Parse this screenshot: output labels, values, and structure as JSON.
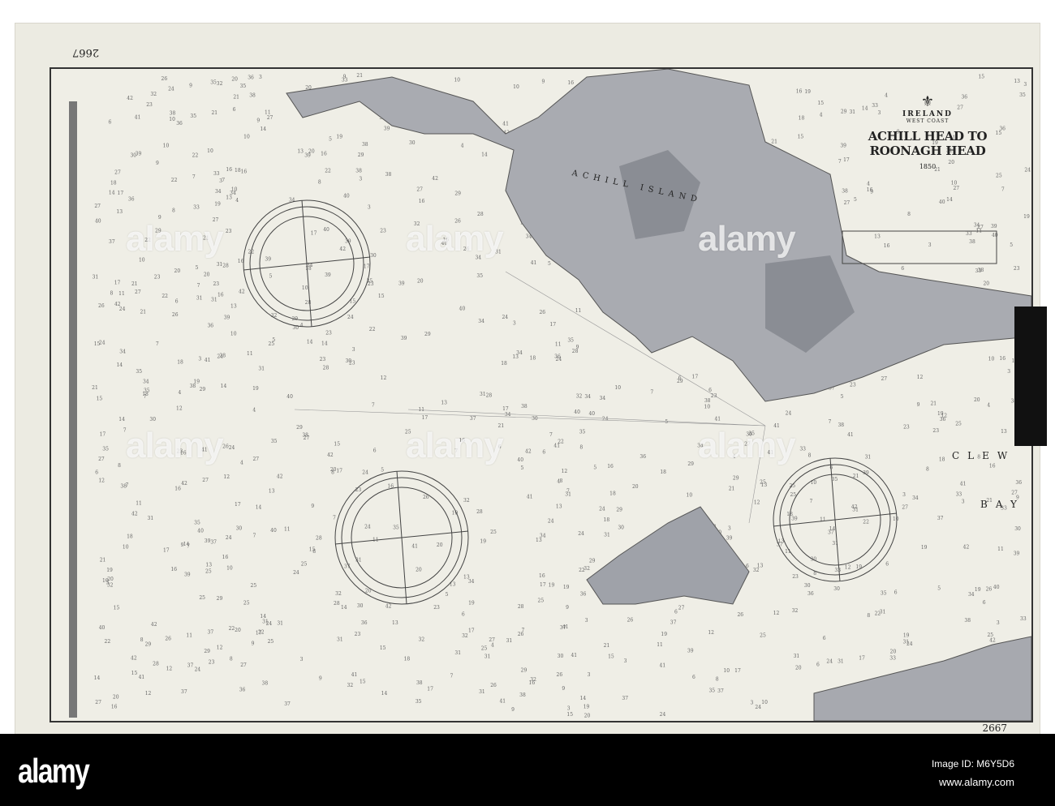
{
  "chart": {
    "sheet_number": "2667",
    "country": "IRELAND",
    "coast": "WEST COAST",
    "title": "ACHILL HEAD TO ROONAGH HEAD",
    "year": "1850",
    "place_labels": [
      "ACHILL ISLAND",
      "CLEW",
      "BAY"
    ]
  },
  "watermark": "alamy",
  "footer": {
    "logo": "alamy",
    "image_id": "Image ID: M6Y5D6",
    "url": "www.alamy.com"
  },
  "colors": {
    "paper": "#ecebe2",
    "land": "#8c8f96",
    "footer": "#000000"
  }
}
